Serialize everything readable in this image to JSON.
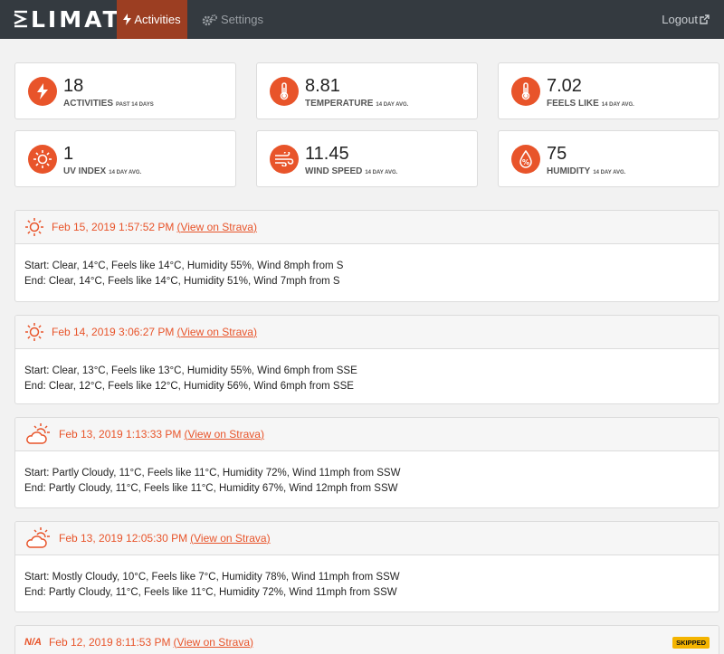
{
  "nav": {
    "brand": "LIMAT",
    "activities": "Activities",
    "settings": "Settings",
    "logout": "Logout"
  },
  "colors": {
    "accent": "#e8542a",
    "navbar": "#343a40",
    "active_tab": "#9c3e22",
    "badge": "#f4b400"
  },
  "stats": [
    {
      "icon": "lightning-icon",
      "value": "18",
      "label": "Activities",
      "sub": "PAST 14 DAYS"
    },
    {
      "icon": "thermometer-icon",
      "value": "8.81",
      "label": "Temperature",
      "sub": "14 DAY AVG."
    },
    {
      "icon": "thermometer-icon",
      "value": "7.02",
      "label": "Feels Like",
      "sub": "14 DAY AVG."
    },
    {
      "icon": "sun-icon",
      "value": "1",
      "label": "UV Index",
      "sub": "14 DAY AVG."
    },
    {
      "icon": "wind-icon",
      "value": "11.45",
      "label": "Wind Speed",
      "sub": "14 DAY AVG."
    },
    {
      "icon": "percent-drop-icon",
      "value": "75",
      "label": "Humidity",
      "sub": "14 DAY AVG."
    }
  ],
  "activities": [
    {
      "icon": "sun-icon",
      "date": "Feb 15, 2019 1:57:52 PM",
      "link": "View on Strava",
      "start": "Start: Clear, 14°C, Feels like 14°C, Humidity 55%, Wind 8mph from S",
      "end": "End: Clear, 14°C, Feels like 14°C, Humidity 51%, Wind 7mph from S"
    },
    {
      "icon": "sun-icon",
      "date": "Feb 14, 2019 3:06:27 PM",
      "link": "View on Strava",
      "start": "Start: Clear, 13°C, Feels like 13°C, Humidity 55%, Wind 6mph from SSE",
      "end": "End: Clear, 12°C, Feels like 12°C, Humidity 56%, Wind 6mph from SSE"
    },
    {
      "icon": "partly-cloudy-icon",
      "date": "Feb 13, 2019 1:13:33 PM",
      "link": "View on Strava",
      "start": "Start: Partly Cloudy, 11°C, Feels like 11°C, Humidity 72%, Wind 11mph from SSW",
      "end": "End: Partly Cloudy, 11°C, Feels like 11°C, Humidity 67%, Wind 12mph from SSW"
    },
    {
      "icon": "partly-cloudy-icon",
      "date": "Feb 13, 2019 12:05:30 PM",
      "link": "View on Strava",
      "start": "Start: Mostly Cloudy, 10°C, Feels like 7°C, Humidity 78%, Wind 11mph from SSW",
      "end": "End: Partly Cloudy, 11°C, Feels like 11°C, Humidity 72%, Wind 11mph from SSW"
    },
    {
      "icon": "na",
      "na_text": "N/A",
      "date": "Feb 12, 2019 8:11:53 PM",
      "link": "View on Strava",
      "badge": "SKIPPED"
    }
  ]
}
